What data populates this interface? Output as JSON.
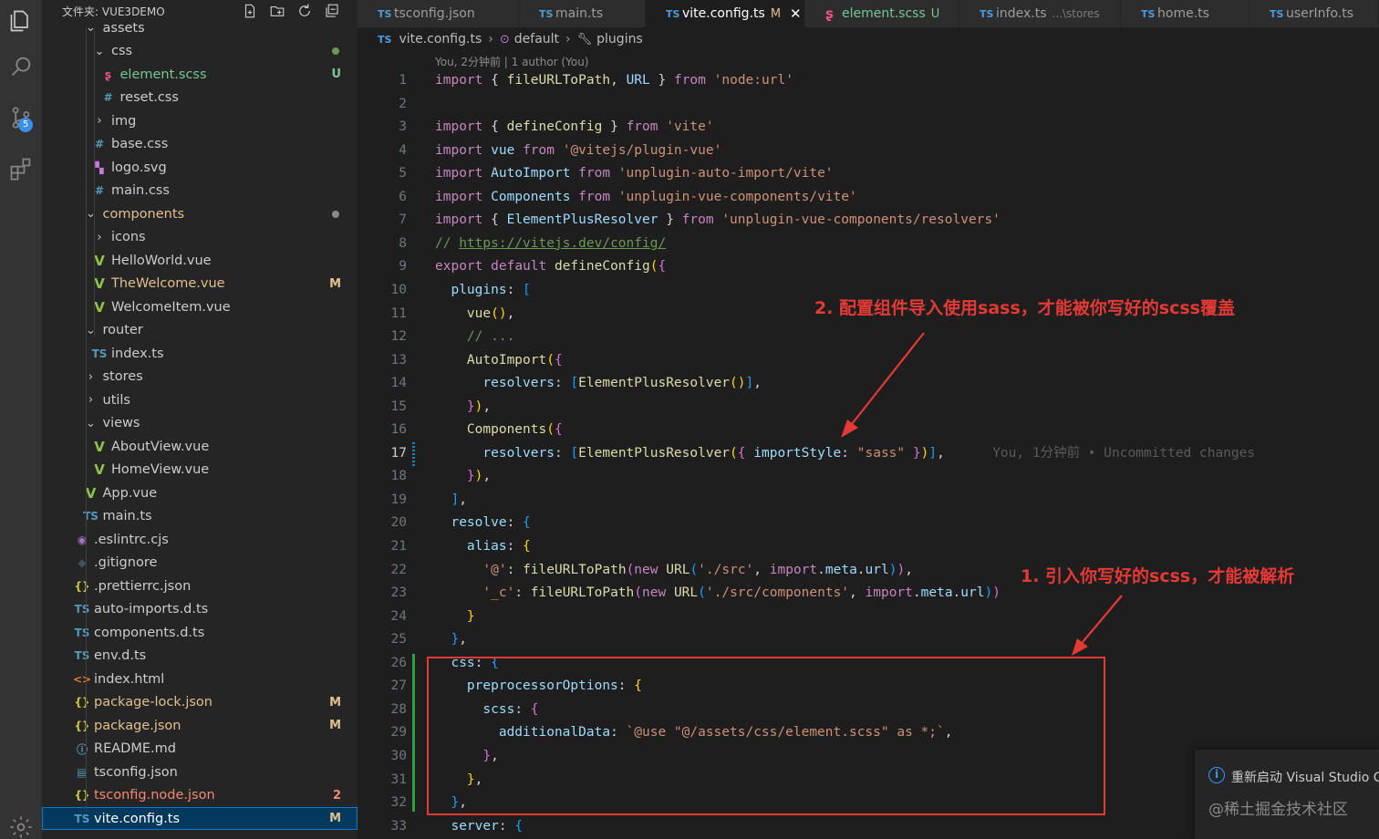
{
  "activity_bar": {
    "items": [
      {
        "name": "explorer-icon"
      },
      {
        "name": "search-icon"
      },
      {
        "name": "source-control-icon",
        "badge": "5"
      },
      {
        "name": "extensions-icon"
      },
      {
        "name": "settings-gear-icon"
      }
    ]
  },
  "sidebar": {
    "title": "文件夹: VUE3DEMO",
    "rows": [
      {
        "label": "assets",
        "kind": "folder-open",
        "depth": 3,
        "color": "#cccccc"
      },
      {
        "label": "css",
        "kind": "folder-open",
        "depth": 4,
        "color": "#cccccc",
        "dot": "#6a9955"
      },
      {
        "label": "element.scss",
        "kind": "scss",
        "depth": 5,
        "color": "#73c991",
        "badge": "U",
        "badge_color": "#73c991"
      },
      {
        "label": "reset.css",
        "kind": "css",
        "depth": 5,
        "color": "#cccccc"
      },
      {
        "label": "img",
        "kind": "folder",
        "depth": 4,
        "color": "#cccccc"
      },
      {
        "label": "base.css",
        "kind": "css",
        "depth": 4,
        "color": "#cccccc"
      },
      {
        "label": "logo.svg",
        "kind": "svg",
        "depth": 4,
        "color": "#cccccc"
      },
      {
        "label": "main.css",
        "kind": "css",
        "depth": 4,
        "color": "#cccccc"
      },
      {
        "label": "components",
        "kind": "folder-open",
        "depth": 3,
        "color": "#e2c08d",
        "dot": "#8a8a8a"
      },
      {
        "label": "icons",
        "kind": "folder",
        "depth": 4,
        "color": "#cccccc"
      },
      {
        "label": "HelloWorld.vue",
        "kind": "vue",
        "depth": 4,
        "color": "#cccccc"
      },
      {
        "label": "TheWelcome.vue",
        "kind": "vue",
        "depth": 4,
        "color": "#e2c08d",
        "badge": "M",
        "badge_color": "#e2c08d"
      },
      {
        "label": "WelcomeItem.vue",
        "kind": "vue",
        "depth": 4,
        "color": "#cccccc"
      },
      {
        "label": "router",
        "kind": "folder-open",
        "depth": 3,
        "color": "#cccccc"
      },
      {
        "label": "index.ts",
        "kind": "ts",
        "depth": 4,
        "color": "#cccccc"
      },
      {
        "label": "stores",
        "kind": "folder",
        "depth": 3,
        "color": "#cccccc"
      },
      {
        "label": "utils",
        "kind": "folder",
        "depth": 3,
        "color": "#cccccc"
      },
      {
        "label": "views",
        "kind": "folder-open",
        "depth": 3,
        "color": "#cccccc"
      },
      {
        "label": "AboutView.vue",
        "kind": "vue",
        "depth": 4,
        "color": "#cccccc"
      },
      {
        "label": "HomeView.vue",
        "kind": "vue",
        "depth": 4,
        "color": "#cccccc"
      },
      {
        "label": "App.vue",
        "kind": "vue",
        "depth": 3,
        "color": "#cccccc"
      },
      {
        "label": "main.ts",
        "kind": "ts",
        "depth": 3,
        "color": "#cccccc"
      },
      {
        "label": ".eslintrc.cjs",
        "kind": "eslint",
        "depth": 2,
        "color": "#cccccc"
      },
      {
        "label": ".gitignore",
        "kind": "git",
        "depth": 2,
        "color": "#cccccc"
      },
      {
        "label": ".prettierrc.json",
        "kind": "json",
        "depth": 2,
        "color": "#cccccc"
      },
      {
        "label": "auto-imports.d.ts",
        "kind": "ts",
        "depth": 2,
        "color": "#cccccc"
      },
      {
        "label": "components.d.ts",
        "kind": "ts",
        "depth": 2,
        "color": "#cccccc"
      },
      {
        "label": "env.d.ts",
        "kind": "ts",
        "depth": 2,
        "color": "#cccccc"
      },
      {
        "label": "index.html",
        "kind": "html",
        "depth": 2,
        "color": "#cccccc"
      },
      {
        "label": "package-lock.json",
        "kind": "json",
        "depth": 2,
        "color": "#e2c08d",
        "badge": "M",
        "badge_color": "#e2c08d"
      },
      {
        "label": "package.json",
        "kind": "json",
        "depth": 2,
        "color": "#e2c08d",
        "badge": "M",
        "badge_color": "#e2c08d"
      },
      {
        "label": "README.md",
        "kind": "info",
        "depth": 2,
        "color": "#cccccc"
      },
      {
        "label": "tsconfig.json",
        "kind": "tsconfig",
        "depth": 2,
        "color": "#cccccc"
      },
      {
        "label": "tsconfig.node.json",
        "kind": "json",
        "depth": 2,
        "color": "#f48771",
        "badge": "2",
        "badge_color": "#f48771"
      },
      {
        "label": "vite.config.ts",
        "kind": "ts",
        "depth": 2,
        "color": "#ffffff",
        "badge": "M",
        "badge_color": "#e2c08d",
        "selected": true
      }
    ]
  },
  "tabs": [
    {
      "icon": "TS",
      "label": "tsconfig.json",
      "suffix": "",
      "sub": ""
    },
    {
      "icon": "TS",
      "label": "main.ts",
      "suffix": "",
      "sub": ""
    },
    {
      "icon": "TS",
      "label": "vite.config.ts",
      "suffix": "M",
      "sub": "",
      "active": true
    },
    {
      "icon": "scss",
      "label": "element.scss",
      "suffix": "U",
      "sub": ""
    },
    {
      "icon": "TS",
      "label": "index.ts",
      "suffix": "",
      "sub": "...\\stores"
    },
    {
      "icon": "TS",
      "label": "home.ts",
      "suffix": "",
      "sub": ""
    },
    {
      "icon": "TS",
      "label": "userInfo.ts",
      "suffix": "",
      "sub": ""
    }
  ],
  "breadcrumb": {
    "file": "vite.config.ts",
    "symbol": "default",
    "prop": "plugins"
  },
  "blame": "You, 2分钟前 | 1 author (You)",
  "current_line": 17,
  "code": [
    {
      "n": 1,
      "tokens": [
        [
          "kw",
          "import"
        ],
        [
          "pl",
          " { "
        ],
        [
          "fn",
          "fileURLToPath"
        ],
        [
          "pl",
          ", "
        ],
        [
          "var",
          "URL"
        ],
        [
          "pl",
          " } "
        ],
        [
          "kw",
          "from"
        ],
        [
          "pl",
          " "
        ],
        [
          "str",
          "'node:url'"
        ]
      ]
    },
    {
      "n": 2,
      "tokens": []
    },
    {
      "n": 3,
      "tokens": [
        [
          "kw",
          "import"
        ],
        [
          "pl",
          " { "
        ],
        [
          "fn",
          "defineConfig"
        ],
        [
          "pl",
          " } "
        ],
        [
          "kw",
          "from"
        ],
        [
          "pl",
          " "
        ],
        [
          "str",
          "'vite'"
        ]
      ]
    },
    {
      "n": 4,
      "tokens": [
        [
          "kw",
          "import"
        ],
        [
          "pl",
          " "
        ],
        [
          "var",
          "vue"
        ],
        [
          "pl",
          " "
        ],
        [
          "kw",
          "from"
        ],
        [
          "pl",
          " "
        ],
        [
          "str",
          "'@vitejs/plugin-vue'"
        ]
      ]
    },
    {
      "n": 5,
      "tokens": [
        [
          "kw",
          "import"
        ],
        [
          "pl",
          " "
        ],
        [
          "var",
          "AutoImport"
        ],
        [
          "pl",
          " "
        ],
        [
          "kw",
          "from"
        ],
        [
          "pl",
          " "
        ],
        [
          "str",
          "'unplugin-auto-import/vite'"
        ]
      ]
    },
    {
      "n": 6,
      "tokens": [
        [
          "kw",
          "import"
        ],
        [
          "pl",
          " "
        ],
        [
          "var",
          "Components"
        ],
        [
          "pl",
          " "
        ],
        [
          "kw",
          "from"
        ],
        [
          "pl",
          " "
        ],
        [
          "str",
          "'unplugin-vue-components/vite'"
        ]
      ]
    },
    {
      "n": 7,
      "tokens": [
        [
          "kw",
          "import"
        ],
        [
          "pl",
          " { "
        ],
        [
          "var",
          "ElementPlusResolver"
        ],
        [
          "pl",
          " } "
        ],
        [
          "kw",
          "from"
        ],
        [
          "pl",
          " "
        ],
        [
          "str",
          "'unplugin-vue-components/resolvers'"
        ]
      ]
    },
    {
      "n": 8,
      "tokens": [
        [
          "cmt",
          "// "
        ],
        [
          "url",
          "https://vitejs.dev/config/"
        ]
      ]
    },
    {
      "n": 9,
      "tokens": [
        [
          "kw",
          "export"
        ],
        [
          "pl",
          " "
        ],
        [
          "kw",
          "default"
        ],
        [
          "pl",
          " "
        ],
        [
          "fn",
          "defineConfig"
        ],
        [
          "br1",
          "("
        ],
        [
          "br2",
          "{"
        ]
      ]
    },
    {
      "n": 10,
      "tokens": [
        [
          "pl",
          "  "
        ],
        [
          "var",
          "plugins"
        ],
        [
          "pl",
          ": "
        ],
        [
          "br3",
          "["
        ]
      ]
    },
    {
      "n": 11,
      "tokens": [
        [
          "pl",
          "    "
        ],
        [
          "fn",
          "vue"
        ],
        [
          "br1",
          "()"
        ],
        [
          "pl",
          ","
        ]
      ]
    },
    {
      "n": 12,
      "tokens": [
        [
          "pl",
          "    "
        ],
        [
          "cmt",
          "// ..."
        ]
      ]
    },
    {
      "n": 13,
      "tokens": [
        [
          "pl",
          "    "
        ],
        [
          "fn",
          "AutoImport"
        ],
        [
          "br1",
          "("
        ],
        [
          "br2",
          "{"
        ]
      ]
    },
    {
      "n": 14,
      "tokens": [
        [
          "pl",
          "      "
        ],
        [
          "var",
          "resolvers"
        ],
        [
          "pl",
          ": "
        ],
        [
          "br3",
          "["
        ],
        [
          "fn",
          "ElementPlusResolver"
        ],
        [
          "br1",
          "()"
        ],
        [
          "br3",
          "]"
        ],
        [
          "pl",
          ","
        ]
      ]
    },
    {
      "n": 15,
      "tokens": [
        [
          "pl",
          "    "
        ],
        [
          "br2",
          "}"
        ],
        [
          "br1",
          ")"
        ],
        [
          "pl",
          ","
        ]
      ]
    },
    {
      "n": 16,
      "tokens": [
        [
          "pl",
          "    "
        ],
        [
          "fn",
          "Components"
        ],
        [
          "br1",
          "("
        ],
        [
          "br2",
          "{"
        ]
      ]
    },
    {
      "n": 17,
      "tokens": [
        [
          "pl",
          "      "
        ],
        [
          "var",
          "resolvers"
        ],
        [
          "pl",
          ": "
        ],
        [
          "br3",
          "["
        ],
        [
          "fn",
          "ElementPlusResolver"
        ],
        [
          "br1",
          "("
        ],
        [
          "br2",
          "{"
        ],
        [
          "pl",
          " "
        ],
        [
          "var",
          "importStyle"
        ],
        [
          "pl",
          ": "
        ],
        [
          "str",
          "\"sass\""
        ],
        [
          "pl",
          " "
        ],
        [
          "br2",
          "}"
        ],
        [
          "br1",
          ")"
        ],
        [
          "br3",
          "]"
        ],
        [
          "pl",
          ","
        ],
        [
          "inl",
          "      You, 1分钟前 • Uncommitted changes"
        ]
      ]
    },
    {
      "n": 18,
      "tokens": [
        [
          "pl",
          "    "
        ],
        [
          "br2",
          "}"
        ],
        [
          "br1",
          ")"
        ],
        [
          "pl",
          ","
        ]
      ]
    },
    {
      "n": 19,
      "tokens": [
        [
          "pl",
          "  "
        ],
        [
          "br3",
          "]"
        ],
        [
          "pl",
          ","
        ]
      ]
    },
    {
      "n": 20,
      "tokens": [
        [
          "pl",
          "  "
        ],
        [
          "var",
          "resolve"
        ],
        [
          "pl",
          ": "
        ],
        [
          "br3",
          "{"
        ]
      ]
    },
    {
      "n": 21,
      "tokens": [
        [
          "pl",
          "    "
        ],
        [
          "var",
          "alias"
        ],
        [
          "pl",
          ": "
        ],
        [
          "br1",
          "{"
        ]
      ]
    },
    {
      "n": 22,
      "tokens": [
        [
          "pl",
          "      "
        ],
        [
          "str",
          "'@'"
        ],
        [
          "pl",
          ": "
        ],
        [
          "fn",
          "fileURLToPath"
        ],
        [
          "br2",
          "("
        ],
        [
          "kw",
          "new"
        ],
        [
          "pl",
          " "
        ],
        [
          "fn",
          "URL"
        ],
        [
          "br3",
          "("
        ],
        [
          "str",
          "'./src'"
        ],
        [
          "pl",
          ", "
        ],
        [
          "kw",
          "import"
        ],
        [
          "pl",
          "."
        ],
        [
          "var",
          "meta"
        ],
        [
          "pl",
          "."
        ],
        [
          "var",
          "url"
        ],
        [
          "br3",
          ")"
        ],
        [
          "br2",
          ")"
        ],
        [
          "pl",
          ","
        ]
      ]
    },
    {
      "n": 23,
      "tokens": [
        [
          "pl",
          "      "
        ],
        [
          "str",
          "'_c'"
        ],
        [
          "pl",
          ": "
        ],
        [
          "fn",
          "fileURLToPath"
        ],
        [
          "br2",
          "("
        ],
        [
          "kw",
          "new"
        ],
        [
          "pl",
          " "
        ],
        [
          "fn",
          "URL"
        ],
        [
          "br3",
          "("
        ],
        [
          "str",
          "'./src/components'"
        ],
        [
          "pl",
          ", "
        ],
        [
          "kw",
          "import"
        ],
        [
          "pl",
          "."
        ],
        [
          "var",
          "meta"
        ],
        [
          "pl",
          "."
        ],
        [
          "var",
          "url"
        ],
        [
          "br3",
          ")"
        ],
        [
          "br2",
          ")"
        ]
      ]
    },
    {
      "n": 24,
      "tokens": [
        [
          "pl",
          "    "
        ],
        [
          "br1",
          "}"
        ]
      ]
    },
    {
      "n": 25,
      "tokens": [
        [
          "pl",
          "  "
        ],
        [
          "br3",
          "}"
        ],
        [
          "pl",
          ","
        ]
      ]
    },
    {
      "n": 26,
      "tokens": [
        [
          "pl",
          "  "
        ],
        [
          "var",
          "css"
        ],
        [
          "pl",
          ": "
        ],
        [
          "br3",
          "{"
        ]
      ]
    },
    {
      "n": 27,
      "tokens": [
        [
          "pl",
          "    "
        ],
        [
          "var",
          "preprocessorOptions"
        ],
        [
          "pl",
          ": "
        ],
        [
          "br1",
          "{"
        ]
      ]
    },
    {
      "n": 28,
      "tokens": [
        [
          "pl",
          "      "
        ],
        [
          "var",
          "scss"
        ],
        [
          "pl",
          ": "
        ],
        [
          "br2",
          "{"
        ]
      ]
    },
    {
      "n": 29,
      "tokens": [
        [
          "pl",
          "        "
        ],
        [
          "var",
          "additionalData"
        ],
        [
          "pl",
          ": "
        ],
        [
          "str",
          "`@use \"@/assets/css/element.scss\" as *;`"
        ],
        [
          "pl",
          ","
        ]
      ]
    },
    {
      "n": 30,
      "tokens": [
        [
          "pl",
          "      "
        ],
        [
          "br2",
          "}"
        ],
        [
          "pl",
          ","
        ]
      ]
    },
    {
      "n": 31,
      "tokens": [
        [
          "pl",
          "    "
        ],
        [
          "br1",
          "}"
        ],
        [
          "pl",
          ","
        ]
      ]
    },
    {
      "n": 32,
      "tokens": [
        [
          "pl",
          "  "
        ],
        [
          "br3",
          "}"
        ],
        [
          "pl",
          ","
        ]
      ]
    },
    {
      "n": 33,
      "tokens": [
        [
          "pl",
          "  "
        ],
        [
          "var",
          "server"
        ],
        [
          "pl",
          ": "
        ],
        [
          "br3",
          "{"
        ]
      ]
    }
  ],
  "annotations": [
    {
      "text": "2. 配置组件导入使用sass，才能被你写好的scss覆盖",
      "color": "#e53935"
    },
    {
      "text": "1. 引入你写好的scss，才能被解析",
      "color": "#e53935"
    }
  ],
  "notification": {
    "text": "重新启动 Visual Studio C"
  },
  "watermark": "@稀土掘金技术社区",
  "colors": {
    "accent": "#0078d4",
    "annotation_red": "#e53935",
    "modified": "#e2c08d",
    "untracked": "#73c991",
    "error": "#f48771"
  }
}
